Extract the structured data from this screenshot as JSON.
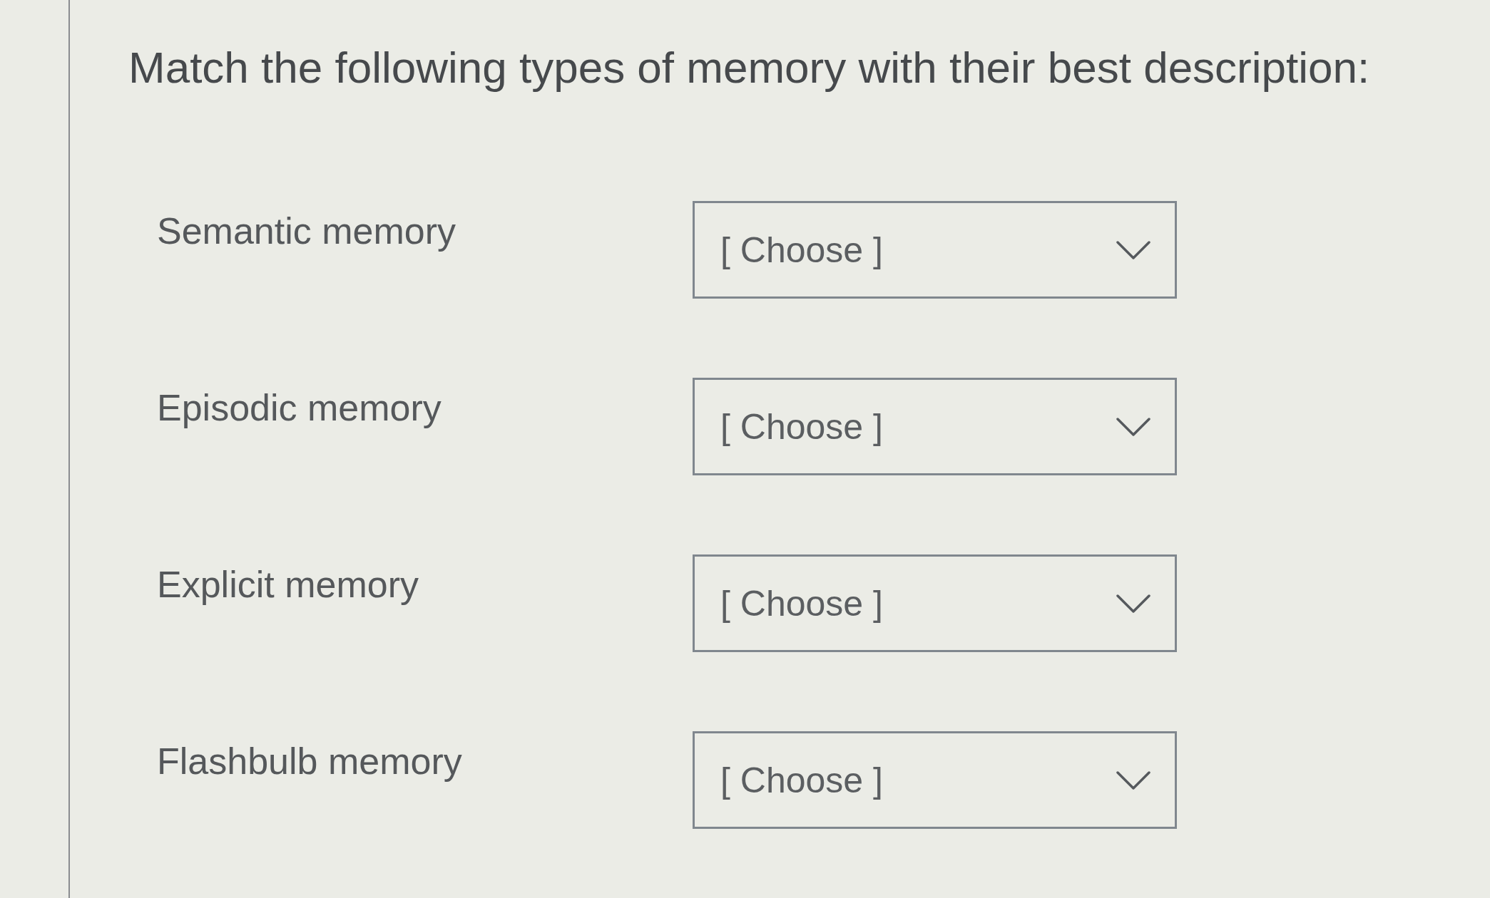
{
  "question": {
    "title": "Match the following types of memory with their best description:"
  },
  "items": [
    {
      "label": "Semantic memory",
      "dropdown": {
        "value": "[ Choose ]"
      }
    },
    {
      "label": "Episodic memory",
      "dropdown": {
        "value": "[ Choose ]"
      }
    },
    {
      "label": "Explicit memory",
      "dropdown": {
        "value": "[ Choose ]"
      }
    },
    {
      "label": "Flashbulb memory",
      "dropdown": {
        "value": "[ Choose ]"
      }
    }
  ]
}
